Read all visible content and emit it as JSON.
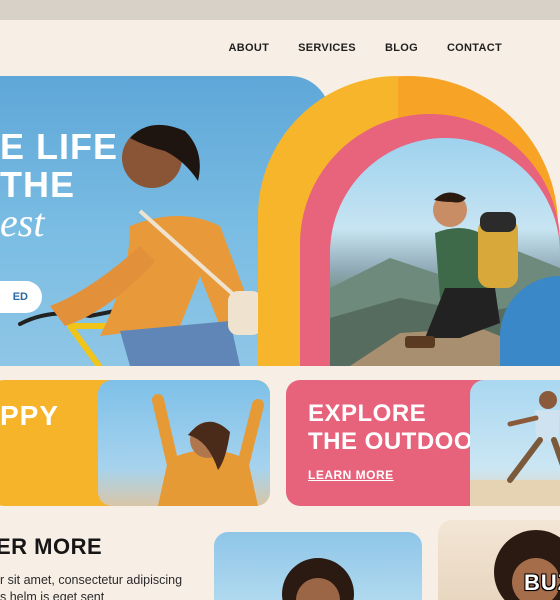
{
  "nav": {
    "items": [
      {
        "label": "ABOUT"
      },
      {
        "label": "SERVICES"
      },
      {
        "label": "BLOG"
      },
      {
        "label": "CONTACT"
      }
    ]
  },
  "hero": {
    "line1": "E LIFE",
    "line2": "THE",
    "line3": "est",
    "button_label": "ED"
  },
  "cards": {
    "yellow": {
      "title": "PPY"
    },
    "pink": {
      "title_line1": "EXPLORE",
      "title_line2": "THE OUTDOORS",
      "cta": "LEARN MORE"
    }
  },
  "bottom": {
    "heading": "ER MORE",
    "text_line1": "r sit amet, consectetur adipiscing",
    "text_line2": "s helm is eget sent"
  },
  "watermark": "BUZ",
  "colors": {
    "background": "#f7efe6",
    "sky_blue": "#5ea7d8",
    "orange": "#f6a326",
    "yellow": "#f5b42a",
    "pink": "#e7637c",
    "accent_blue": "#3a88c8"
  }
}
